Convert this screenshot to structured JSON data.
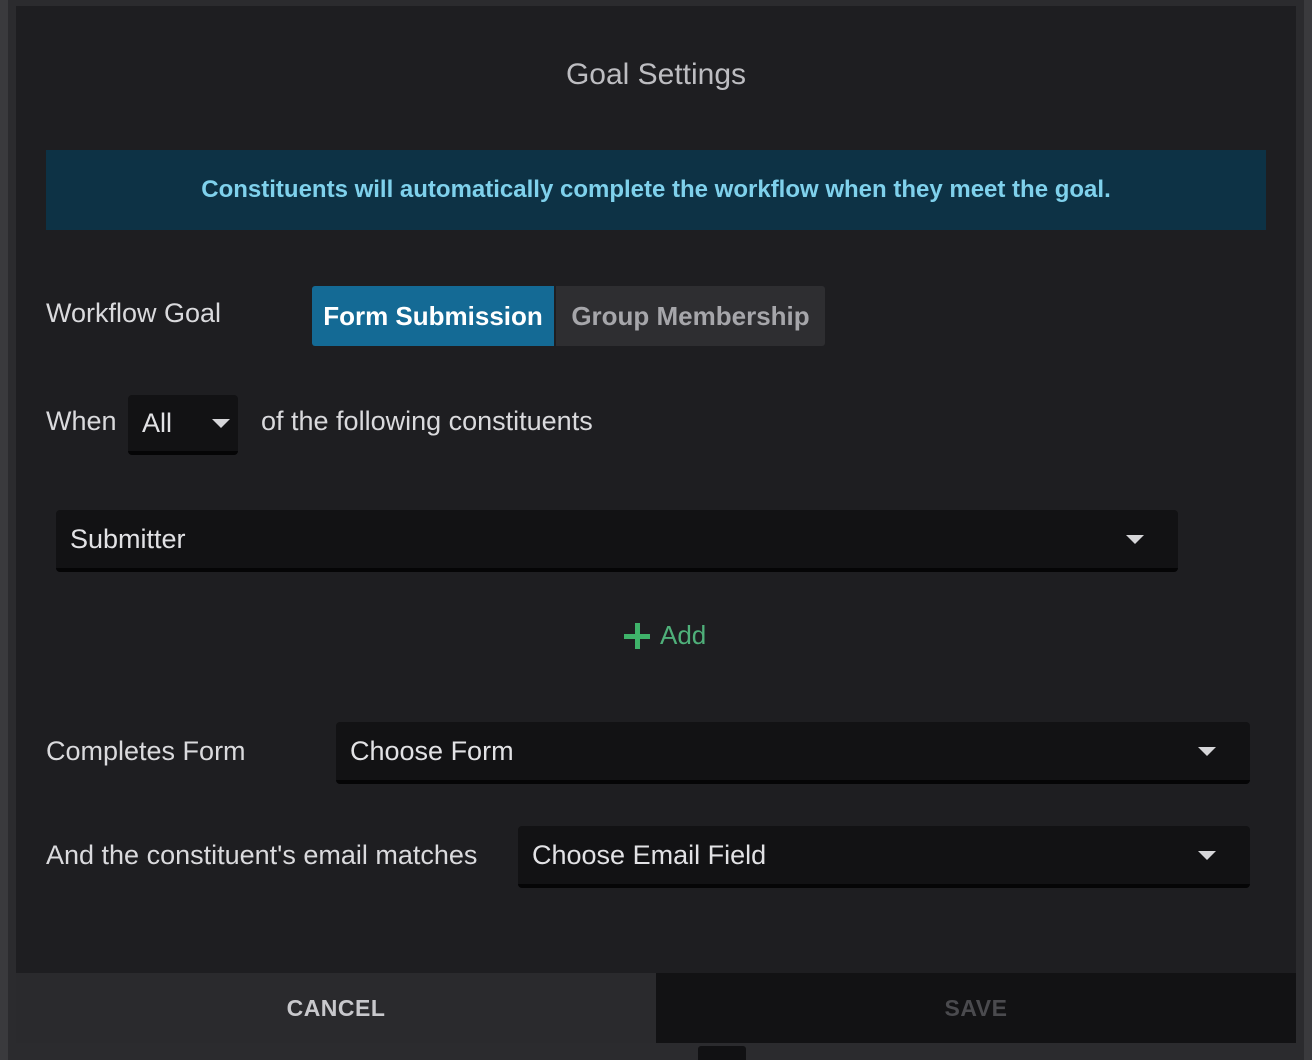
{
  "dialog": {
    "title": "Goal Settings",
    "banner": "Constituents will automatically complete the workflow when they meet the goal."
  },
  "workflow_goal": {
    "label": "Workflow Goal",
    "options": [
      "Form Submission",
      "Group Membership"
    ],
    "selected": "Form Submission"
  },
  "when_row": {
    "prefix": "When",
    "quantifier_value": "All",
    "suffix": "of the following constituents"
  },
  "constituent_select": {
    "value": "Submitter"
  },
  "add_button": {
    "label": "Add"
  },
  "completes_form": {
    "label": "Completes Form",
    "value": "Choose Form"
  },
  "email_match": {
    "label": "And the constituent's email matches",
    "value": "Choose Email Field"
  },
  "footer": {
    "cancel_label": "CANCEL",
    "save_label": "SAVE"
  },
  "colors": {
    "accent": "#146a95",
    "banner_bg": "#0d3245",
    "banner_text": "#7fd1ec",
    "add_green": "#4fb07a"
  }
}
